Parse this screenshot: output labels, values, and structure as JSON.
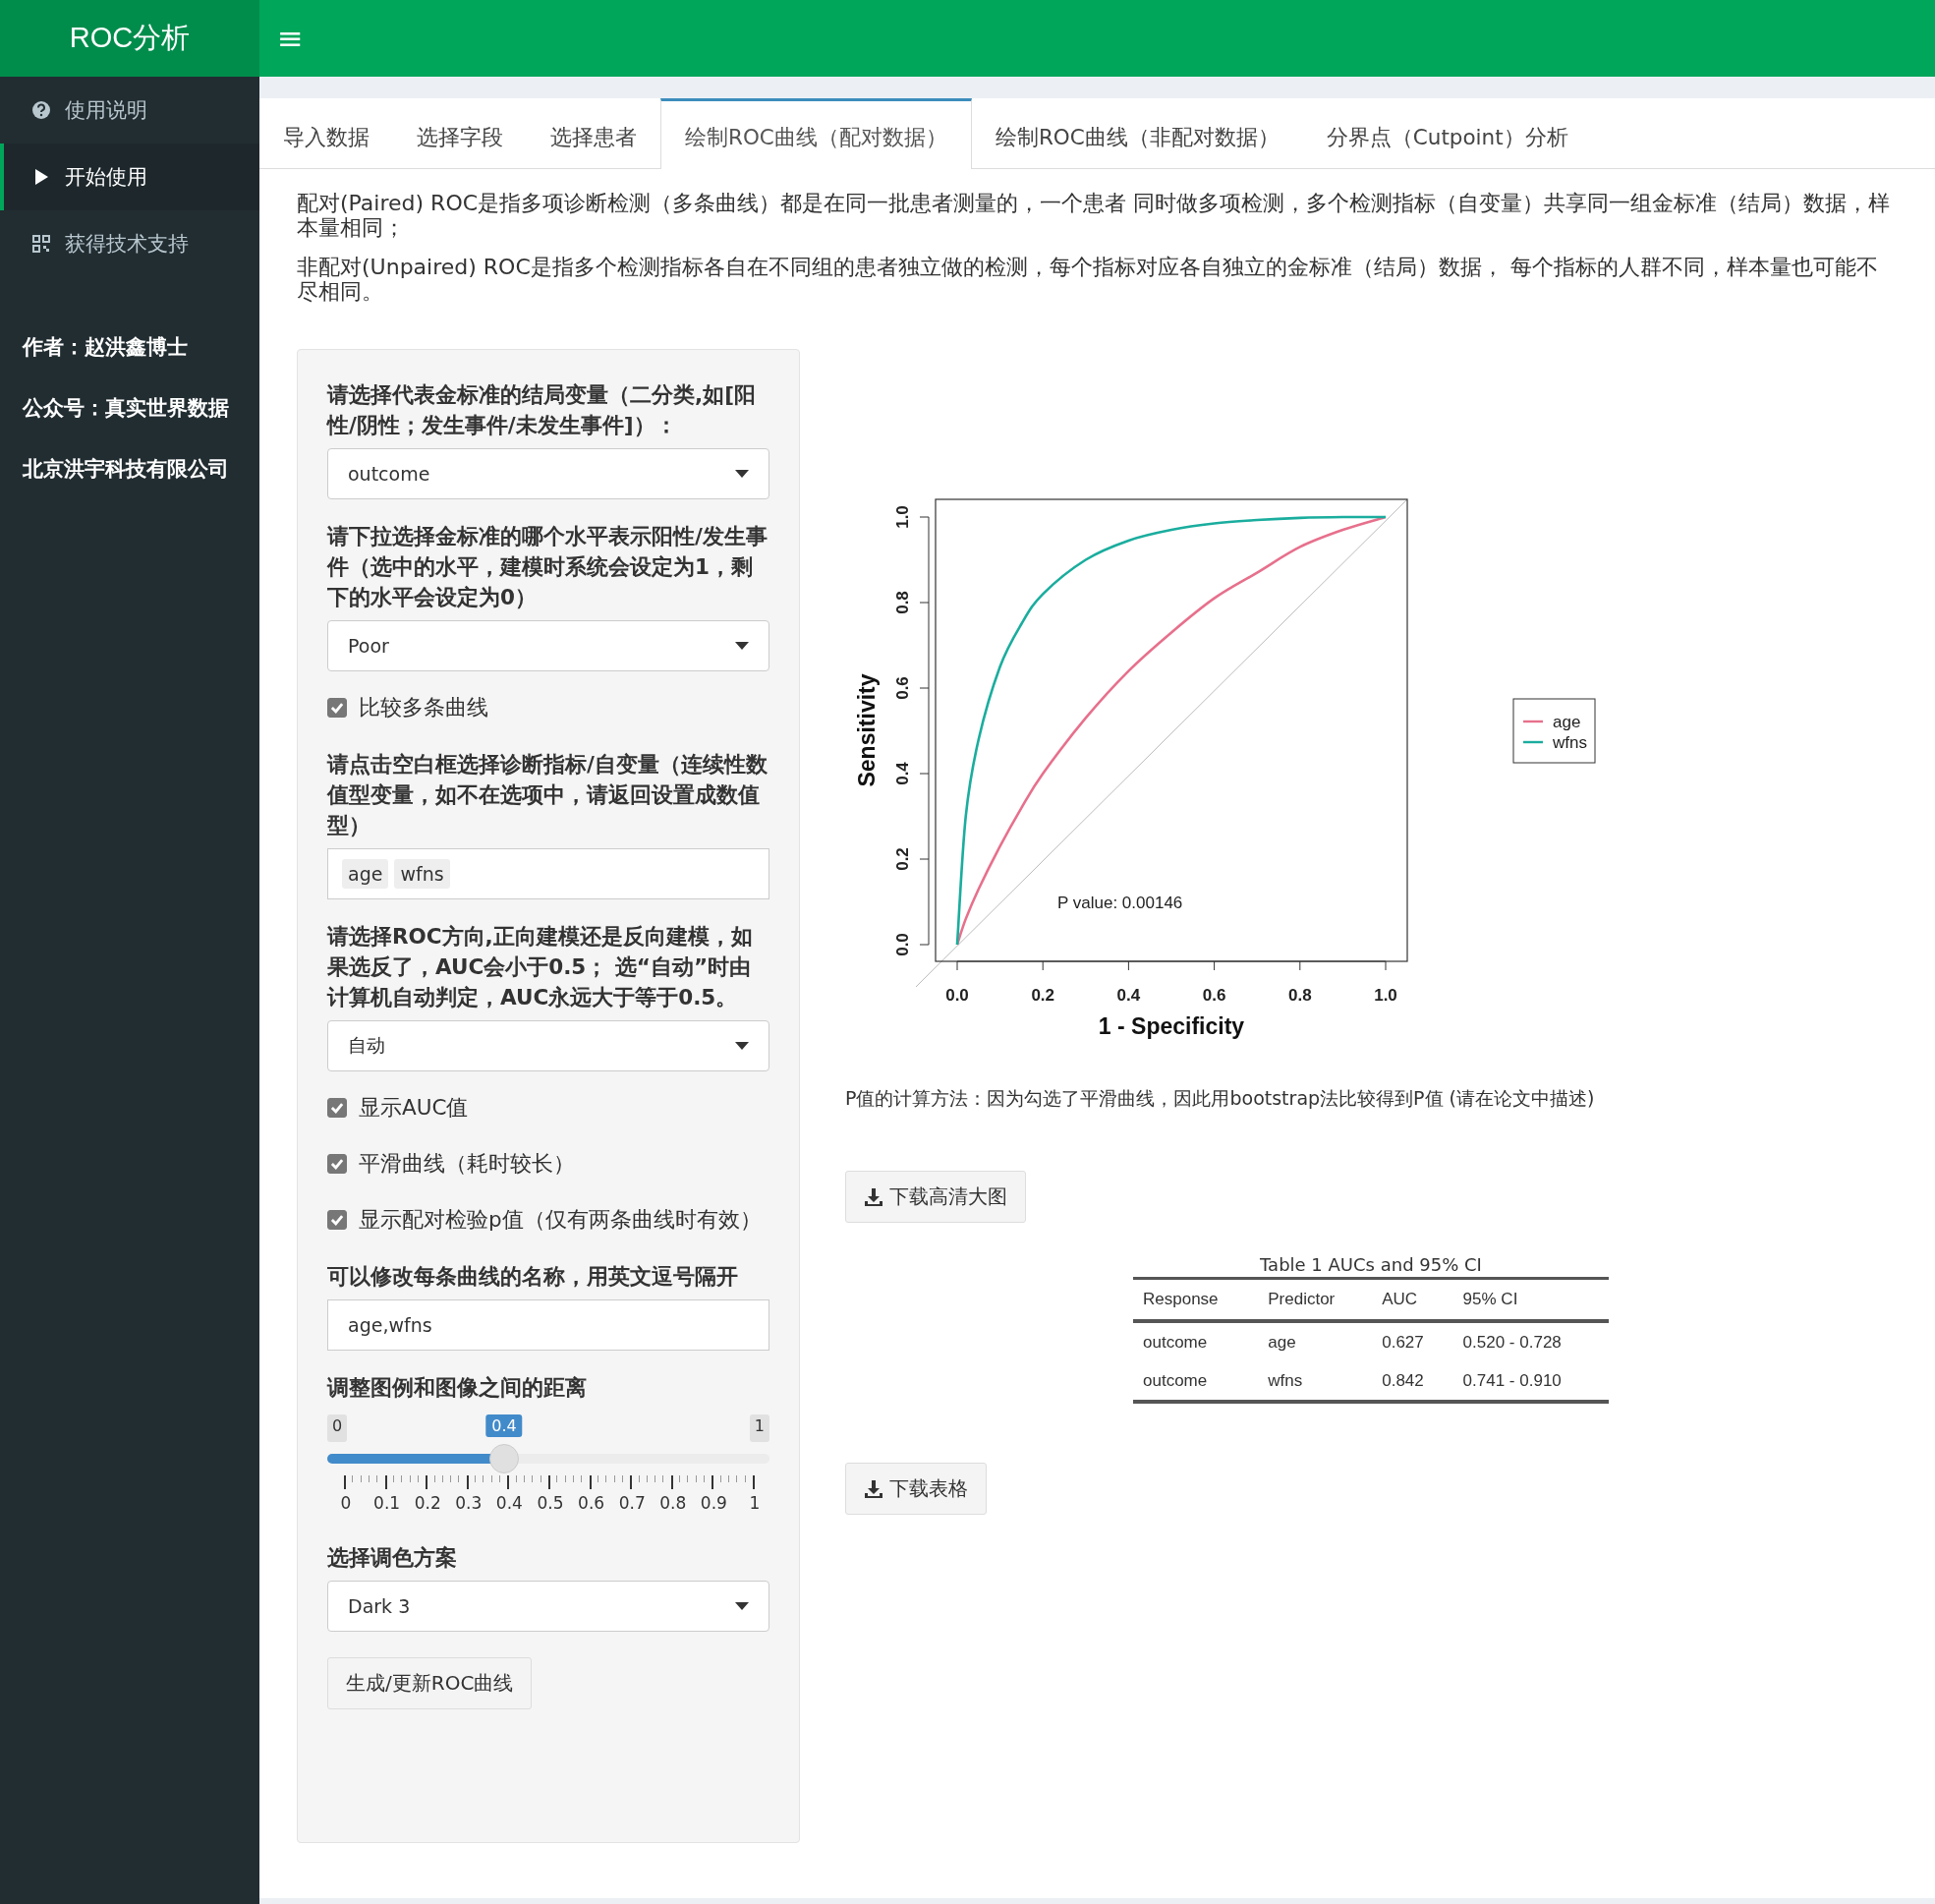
{
  "header": {
    "title": "ROC分析",
    "menu_icon": "≡"
  },
  "sidebar": {
    "items": [
      {
        "label": "使用说明",
        "selected": false
      },
      {
        "label": "开始使用",
        "selected": true
      },
      {
        "label": "获得技术支持",
        "selected": false
      }
    ],
    "info": [
      "作者：赵洪鑫博士",
      "公众号：真实世界数据",
      "北京洪宇科技有限公司"
    ]
  },
  "tabs": [
    {
      "label": "导入数据",
      "selected": false
    },
    {
      "label": "选择字段",
      "selected": false
    },
    {
      "label": "选择患者",
      "selected": false
    },
    {
      "label": "绘制ROC曲线（配对数据）",
      "selected": true
    },
    {
      "label": "绘制ROC曲线（非配对数据）",
      "selected": false
    },
    {
      "label": "分界点（Cutpoint）分析",
      "selected": false
    }
  ],
  "intro": [
    "配对(Paired) ROC是指多项诊断检测（多条曲线）都是在同一批患者测量的，一个患者 同时做多项检测，多个检测指标（自变量）共享同一组金标准（结局）数据，样本量相同；",
    "非配对(Unpaired) ROC是指多个检测指标各自在不同组的患者独立做的检测，每个指标对应各自独立的金标准（结局）数据， 每个指标的人群不同，样本量也可能不尽相同。"
  ],
  "form": [
    {
      "kind": "select",
      "label": "请选择代表金标准的结局变量（二分类,如[阳性/阴性；发生事件/未发生事件]）：",
      "value": "outcome"
    },
    {
      "kind": "select",
      "label": "请下拉选择金标准的哪个水平表示阳性/发生事件（选中的水平，建模时系统会设定为1，剩下的水平会设定为0）",
      "value": "Poor"
    },
    {
      "kind": "checkbox",
      "label": "比较多条曲线",
      "checked": true
    },
    {
      "kind": "tags",
      "label": "请点击空白框选择诊断指标/自变量（连续性数值型变量，如不在选项中，请返回设置成数值型）",
      "tags": [
        "age",
        "wfns"
      ]
    },
    {
      "kind": "select",
      "label": "请选择ROC方向,正向建模还是反向建模，如果选反了，AUC会小于0.5； 选“自动”时由计算机自动判定，AUC永远大于等于0.5。",
      "value": "自动"
    },
    {
      "kind": "checkbox",
      "label": "显示AUC值",
      "checked": true
    },
    {
      "kind": "checkbox",
      "label": "平滑曲线（耗时较长）",
      "checked": true
    },
    {
      "kind": "checkbox",
      "label": "显示配对检验p值（仅有两条曲线时有效）",
      "checked": true
    },
    {
      "kind": "text",
      "label": "可以修改每条曲线的名称，用英文逗号隔开",
      "value": "age,wfns"
    },
    {
      "kind": "slider",
      "label": "调整图例和图像之间的距离",
      "min": "0",
      "max": "1",
      "value": "0.4",
      "level": 0.4,
      "ticks": [
        "0",
        "0.1",
        "0.2",
        "0.3",
        "0.4",
        "0.5",
        "0.6",
        "0.7",
        "0.8",
        "0.9",
        "1"
      ]
    },
    {
      "kind": "select",
      "label": "选择调色方案",
      "value": "Dark 3"
    },
    {
      "kind": "button",
      "label": "生成/更新ROC曲线"
    }
  ],
  "plot": {
    "chart_data": {
      "type": "line",
      "xlabel": "1 - Specificity",
      "ylabel": "Sensitivity",
      "x": [
        0,
        0.02,
        0.05,
        0.1,
        0.15,
        0.2,
        0.3,
        0.4,
        0.5,
        0.6,
        0.7,
        0.8,
        0.9,
        1
      ],
      "xlim": [
        0,
        1
      ],
      "ylim": [
        0,
        1
      ],
      "xticks": [
        {
          "value": 0,
          "label": "0.0"
        },
        {
          "value": 0.2,
          "label": "0.2"
        },
        {
          "value": 0.4,
          "label": "0.4"
        },
        {
          "value": 0.6,
          "label": "0.6"
        },
        {
          "value": 0.8,
          "label": "0.8"
        },
        {
          "value": 1,
          "label": "1.0"
        }
      ],
      "yticks": [
        {
          "value": 0,
          "label": "0.0"
        },
        {
          "value": 0.2,
          "label": "0.2"
        },
        {
          "value": 0.4,
          "label": "0.4"
        },
        {
          "value": 0.6,
          "label": "0.6"
        },
        {
          "value": 0.8,
          "label": "0.8"
        },
        {
          "value": 1,
          "label": "1.0"
        }
      ],
      "series": [
        {
          "name": "age",
          "color": "#e7708c",
          "values": [
            0,
            0.06,
            0.13,
            0.23,
            0.32,
            0.4,
            0.53,
            0.64,
            0.73,
            0.81,
            0.87,
            0.93,
            0.97,
            1
          ]
        },
        {
          "name": "wfns",
          "color": "#1aad9e",
          "values": [
            0,
            0.3,
            0.48,
            0.65,
            0.75,
            0.82,
            0.9,
            0.945,
            0.97,
            0.985,
            0.993,
            0.998,
            1,
            1
          ]
        }
      ],
      "legend": true,
      "annotations": [
        "P value:  0.00146"
      ]
    }
  },
  "p_note": "P值的计算方法：因为勾选了平滑曲线，因此用bootstrap法比较得到P值 (请在论文中描述)",
  "download_plot": "下载高清大图",
  "table": {
    "caption": "Table 1 AUCs and 95% CI",
    "columns": [
      "Response",
      "Predictor",
      "AUC",
      "95% CI"
    ],
    "rows": [
      [
        "outcome",
        "age",
        "0.627",
        "0.520 - 0.728"
      ],
      [
        "outcome",
        "wfns",
        "0.842",
        "0.741 - 0.910"
      ]
    ]
  },
  "download_table": "下载表格"
}
